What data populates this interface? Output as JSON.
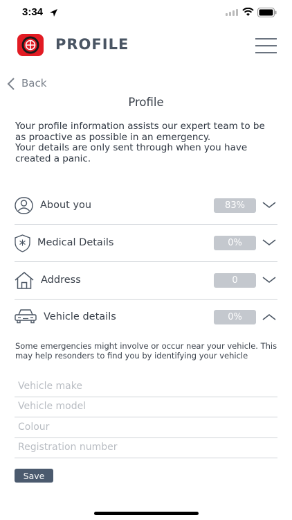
{
  "status_bar": {
    "time": "3:34"
  },
  "header": {
    "title": "PROFILE"
  },
  "nav": {
    "back_label": "Back"
  },
  "page_title": "Profile",
  "intro": {
    "line1": "Your profile information assists our expert team to be as proactive as possible in an emergency.",
    "line2": "Your details are only sent through when you have created a panic."
  },
  "sections": [
    {
      "label": "About you",
      "progress": "83%",
      "icon": "person-icon",
      "expanded": false
    },
    {
      "label": "Medical Details",
      "progress": "0%",
      "icon": "medical-shield-icon",
      "expanded": false
    },
    {
      "label": "Address",
      "progress": "0",
      "icon": "house-icon",
      "expanded": false
    },
    {
      "label": "Vehicle details",
      "progress": "0%",
      "icon": "car-icon",
      "expanded": true
    }
  ],
  "vehicle": {
    "note": "Some emergencies might involve or occur near your vehicle. This may help resonders to find you by identifying your vehicle",
    "fields": [
      {
        "placeholder": "Vehicle make",
        "value": ""
      },
      {
        "placeholder": "Vehicle model",
        "value": ""
      },
      {
        "placeholder": "Colour",
        "value": ""
      },
      {
        "placeholder": "Registration number",
        "value": ""
      }
    ],
    "save_label": "Save"
  },
  "colors": {
    "brand": "#e21b23",
    "badge": "#c4c8ce",
    "button": "#4b5a6e"
  }
}
